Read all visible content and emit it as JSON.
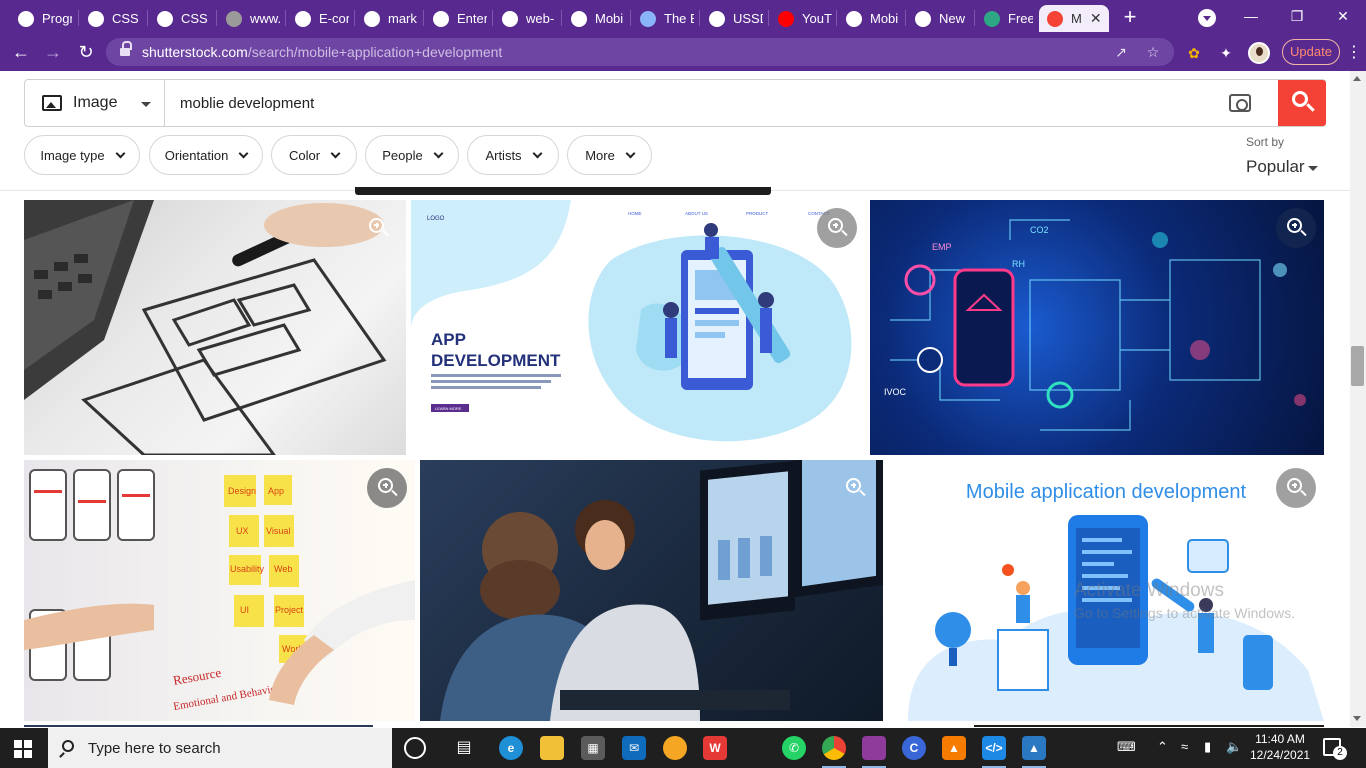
{
  "browser": {
    "tabs": [
      {
        "title": "Progr",
        "icon": "globe-icon",
        "color": "#ffffff"
      },
      {
        "title": "CSS l",
        "icon": "globe-icon",
        "color": "#ffffff"
      },
      {
        "title": "CSS b",
        "icon": "globe-icon",
        "color": "#ffffff"
      },
      {
        "title": "www.",
        "icon": "globe-icon",
        "color": "#9a9a9a"
      },
      {
        "title": "E-cor",
        "icon": "globe-icon",
        "color": "#ffffff"
      },
      {
        "title": "mark",
        "icon": "globe-icon",
        "color": "#ffffff"
      },
      {
        "title": "Enter",
        "icon": "globe-icon",
        "color": "#ffffff"
      },
      {
        "title": "web-",
        "icon": "globe-icon",
        "color": "#ffffff"
      },
      {
        "title": "Mobi",
        "icon": "globe-icon",
        "color": "#ffffff"
      },
      {
        "title": "The B",
        "icon": "theb-icon",
        "color": "#8ab4f8"
      },
      {
        "title": "USSD",
        "icon": "globe-icon",
        "color": "#ffffff"
      },
      {
        "title": "YouT",
        "icon": "youtube-icon",
        "color": "#ff0000"
      },
      {
        "title": "Mobi",
        "icon": "globe-icon",
        "color": "#ffffff"
      },
      {
        "title": "New",
        "icon": "chrome-icon",
        "color": "#ffffff"
      },
      {
        "title": "Free",
        "icon": "dribbble-icon",
        "color": "#2ea784"
      },
      {
        "title": "M",
        "icon": "shutterstock-icon",
        "color": "#f44336"
      }
    ],
    "url_domain": "shutterstock.com",
    "url_path": "/search/mobile+application+development",
    "update_label": "Update"
  },
  "search": {
    "type_label": "Image",
    "query": "moblie development"
  },
  "filters": {
    "chips": [
      "Image type",
      "Orientation",
      "Color",
      "People",
      "Artists",
      "More"
    ]
  },
  "sort": {
    "label": "Sort by",
    "value": "Popular"
  },
  "results": {
    "app_dev_title_1": "APP",
    "app_dev_title_2": "DEVELOPMENT",
    "app_dev_logo": "LOGO",
    "app_dev_nav": [
      "HOME",
      "ABOUT US",
      "PRODUCT",
      "CONTACT"
    ],
    "app_dev_button": "LEARN MORE",
    "circuit_labels": [
      "EMP",
      "CO2",
      "RH",
      "IVOC"
    ],
    "notes_words": [
      "Design",
      "App",
      "UX",
      "Visual",
      "Usability",
      "Web",
      "UI",
      "Project",
      "Work"
    ],
    "notes_caption": "Resource",
    "notes_caption_2": "Emotional and Behavior",
    "mad_title": "Mobile application development"
  },
  "system": {
    "watermark_line1": "Activate Windows",
    "watermark_line2": "Go to Settings to activate Windows.",
    "search_placeholder": "Type here to search",
    "time": "11:40 AM",
    "date": "12/24/2021",
    "notification_count": "2"
  }
}
